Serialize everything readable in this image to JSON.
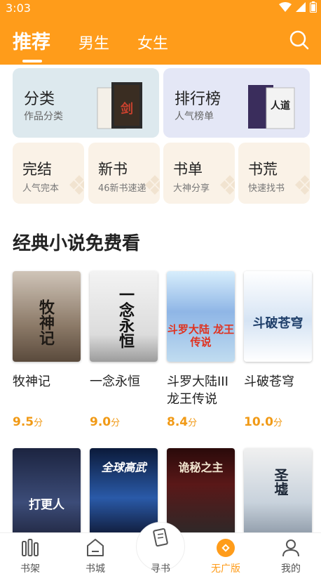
{
  "status": {
    "time": "3:03"
  },
  "header": {
    "tabs": [
      {
        "label": "推荐",
        "active": true
      },
      {
        "label": "男生",
        "active": false
      },
      {
        "label": "女生",
        "active": false
      }
    ],
    "accent": "#ff9c1a"
  },
  "categories": [
    {
      "title": "分类",
      "sub": "作品分类"
    },
    {
      "title": "排行榜",
      "sub": "人气榜单"
    }
  ],
  "quick": [
    {
      "title": "完结",
      "sub": "人气完本"
    },
    {
      "title": "新书",
      "sub": "46新书速递"
    },
    {
      "title": "书单",
      "sub": "大神分享"
    },
    {
      "title": "书荒",
      "sub": "快速找书"
    }
  ],
  "section": {
    "title": "经典小说免费看"
  },
  "books": [
    {
      "title": "牧神记",
      "score": "9.5",
      "unit": "分",
      "cover_text": "牧神记"
    },
    {
      "title": "一念永恒",
      "score": "9.0",
      "unit": "分",
      "cover_text": "一念永恒"
    },
    {
      "title": "斗罗大陆III龙王传说",
      "score": "8.4",
      "unit": "分",
      "cover_text": "斗罗大陆 龙王传说"
    },
    {
      "title": "斗破苍穹",
      "score": "10.0",
      "unit": "分",
      "cover_text": "斗破苍穹"
    }
  ],
  "books_row2": [
    {
      "cover_text": "打更人"
    },
    {
      "cover_text": "全球高武"
    },
    {
      "cover_text": "诡秘之主"
    },
    {
      "cover_text": "圣墟"
    }
  ],
  "bottom_nav": [
    {
      "label": "书架",
      "icon": "bookshelf-icon",
      "active": false
    },
    {
      "label": "书城",
      "icon": "bookstore-icon",
      "active": false
    },
    {
      "label": "寻书",
      "icon": "find-book-icon",
      "active": false
    },
    {
      "label": "无广版",
      "icon": "ad-free-icon",
      "active": true
    },
    {
      "label": "我的",
      "icon": "profile-icon",
      "active": false
    }
  ]
}
